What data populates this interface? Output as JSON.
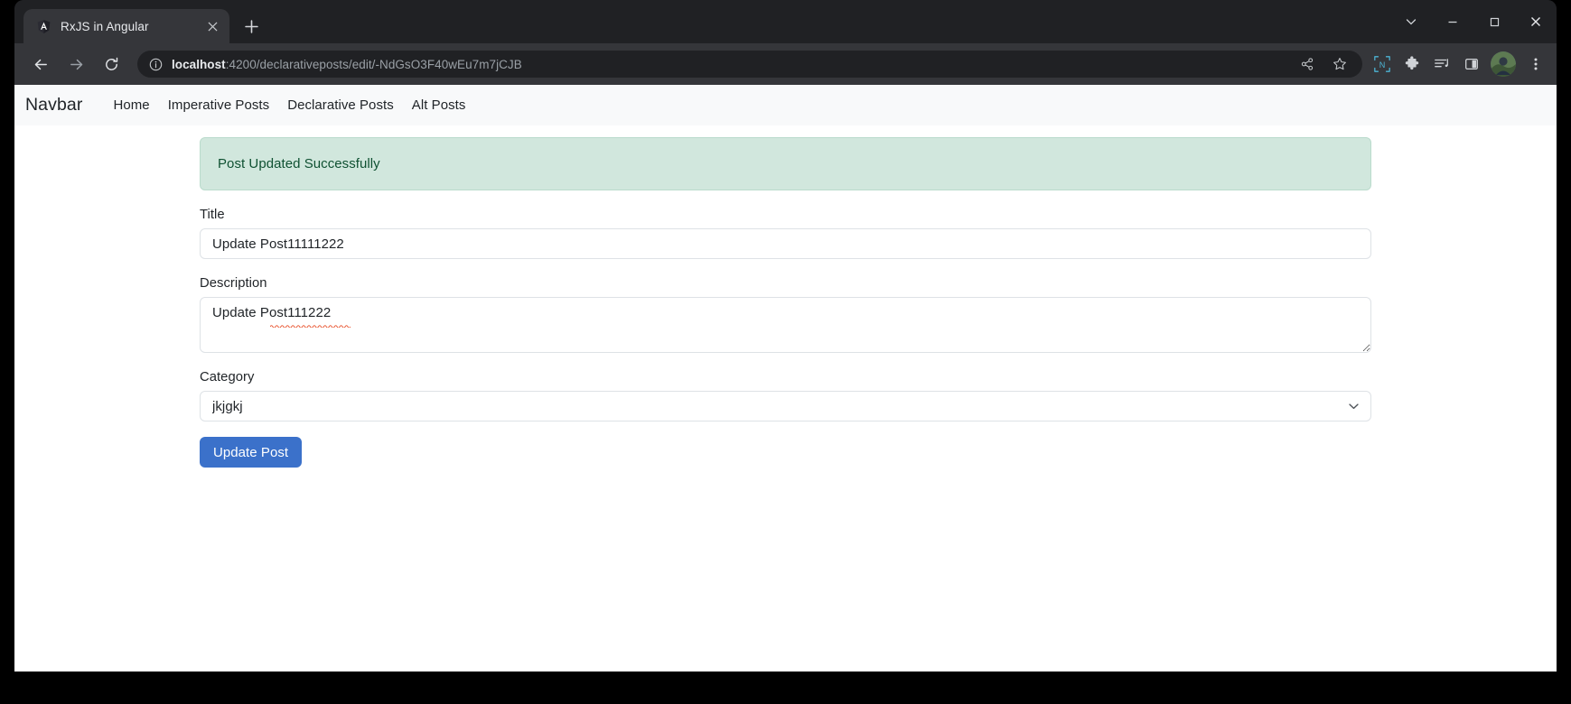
{
  "browser": {
    "tab": {
      "title": "RxJS in Angular",
      "favicon_name": "angular-logo-icon",
      "close_label": "×"
    },
    "new_tab_label": "+",
    "window_controls": {
      "chevron": "chevron-down",
      "minimize": "minimize",
      "maximize": "maximize",
      "close": "close"
    },
    "nav": {
      "back": "back",
      "forward": "forward",
      "reload": "reload"
    },
    "omnibox": {
      "site_info": "info-circle",
      "url_host": "localhost",
      "url_rest": ":4200/declarativeposts/edit/-NdGsO3F40wEu7m7jCJB",
      "full_url": "localhost:4200/declarativeposts/edit/-NdGsO3F40wEu7m7jCJB",
      "share_icon": "share-icon",
      "bookmark_icon": "star-icon"
    },
    "toolbar_icons": [
      "notion-extension-icon",
      "puzzle-extensions-icon",
      "reading-list-icon",
      "side-panel-icon"
    ],
    "profile": "avatar",
    "menu": "three-dot-menu"
  },
  "navbar": {
    "brand": "Navbar",
    "links": [
      {
        "label": "Home"
      },
      {
        "label": "Imperative Posts"
      },
      {
        "label": "Declarative Posts"
      },
      {
        "label": "Alt Posts"
      }
    ]
  },
  "alert": {
    "message": "Post Updated Successfully",
    "bg_color": "#d1e7dd",
    "text_color": "#0f5132"
  },
  "form": {
    "title": {
      "label": "Title",
      "value": "Update Post11111222"
    },
    "description": {
      "label": "Description",
      "value": "Update Post111222"
    },
    "category": {
      "label": "Category",
      "value": "jkjgkj",
      "options": [
        "jkjgkj"
      ]
    },
    "submit": {
      "label": "Update Post",
      "color": "#3b71ca"
    }
  }
}
